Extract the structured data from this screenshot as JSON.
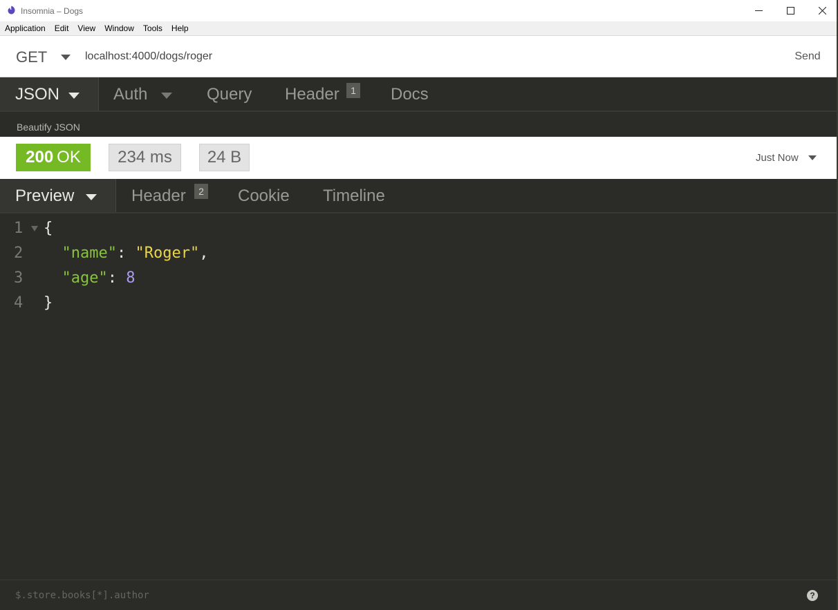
{
  "window": {
    "title": "Insomnia – Dogs",
    "controls": {
      "minimize": "minimize-icon",
      "maximize": "maximize-icon",
      "close": "close-icon"
    }
  },
  "menu": {
    "items": [
      "Application",
      "Edit",
      "View",
      "Window",
      "Tools",
      "Help"
    ]
  },
  "request": {
    "method": "GET",
    "url": "localhost:4000/dogs/roger",
    "send_label": "Send"
  },
  "request_tabs": {
    "body": "JSON",
    "auth": "Auth",
    "query": "Query",
    "header": "Header",
    "header_count": "1",
    "docs": "Docs"
  },
  "body_actions": {
    "beautify": "Beautify JSON"
  },
  "response": {
    "status_code": "200",
    "status_text": "OK",
    "time": "234 ms",
    "size": "24 B",
    "history": "Just Now"
  },
  "response_tabs": {
    "preview": "Preview",
    "header": "Header",
    "header_count": "2",
    "cookie": "Cookie",
    "timeline": "Timeline"
  },
  "code": {
    "lines": [
      {
        "num": "1",
        "open_brace": "{"
      },
      {
        "num": "2",
        "key": "\"name\"",
        "colon": ": ",
        "value": "\"Roger\"",
        "trail": ","
      },
      {
        "num": "3",
        "key": "\"age\"",
        "colon": ": ",
        "value": "8"
      },
      {
        "num": "4",
        "close_brace": "}"
      }
    ]
  },
  "filter": {
    "placeholder": "$.store.books[*].author",
    "help": "?"
  },
  "colors": {
    "status_ok": "#75ba24",
    "panel_dark": "#2b2b27",
    "json_key": "#87c240",
    "json_string": "#e8d54c",
    "json_number": "#a99cf2"
  }
}
